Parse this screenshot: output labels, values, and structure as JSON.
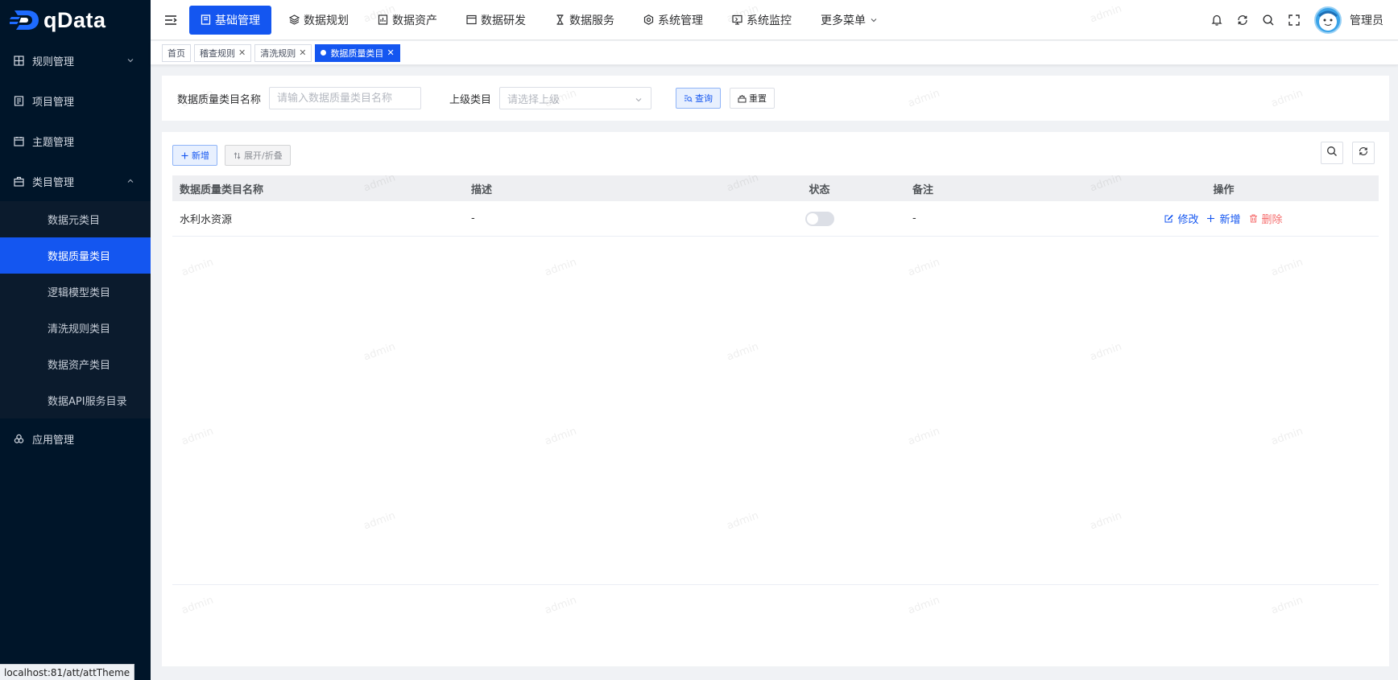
{
  "brand": {
    "name": "qData"
  },
  "sidebar": {
    "items": [
      {
        "label": "规则管理",
        "icon": "grid-icon",
        "expanded": false
      },
      {
        "label": "项目管理",
        "icon": "document-icon"
      },
      {
        "label": "主题管理",
        "icon": "calendar-icon"
      },
      {
        "label": "类目管理",
        "icon": "briefcase-icon",
        "expanded": true,
        "children": [
          {
            "label": "数据元类目"
          },
          {
            "label": "数据质量类目",
            "active": true
          },
          {
            "label": "逻辑模型类目"
          },
          {
            "label": "清洗规则类目"
          },
          {
            "label": "数据资产类目"
          },
          {
            "label": "数据API服务目录"
          }
        ]
      },
      {
        "label": "应用管理",
        "icon": "apps-icon"
      }
    ]
  },
  "topnav": {
    "items": [
      {
        "label": "基础管理",
        "active": true
      },
      {
        "label": "数据规划"
      },
      {
        "label": "数据资产"
      },
      {
        "label": "数据研发"
      },
      {
        "label": "数据服务"
      },
      {
        "label": "系统管理"
      },
      {
        "label": "系统监控"
      },
      {
        "label": "更多菜单"
      }
    ],
    "user": "管理员"
  },
  "tags": [
    {
      "label": "首页"
    },
    {
      "label": "稽查规则"
    },
    {
      "label": "清洗规则"
    },
    {
      "label": "数据质量类目",
      "active": true
    }
  ],
  "search": {
    "name_label": "数据质量类目名称",
    "name_placeholder": "请输入数据质量类目名称",
    "parent_label": "上级类目",
    "parent_placeholder": "请选择上级",
    "query_label": "查询",
    "reset_label": "重置"
  },
  "toolbar": {
    "add_label": "新增",
    "toggle_label": "展开/折叠"
  },
  "table": {
    "headers": [
      "数据质量类目名称",
      "描述",
      "状态",
      "备注",
      "操作"
    ],
    "rows": [
      {
        "name": "水利水资源",
        "desc": "-",
        "status_on": false,
        "remark": "-"
      }
    ],
    "actions": {
      "edit": "修改",
      "add": "新增",
      "delete": "删除"
    }
  },
  "watermark": "admin",
  "statusbar": "localhost:81/att/attTheme",
  "colors": {
    "sidebar_bg": "#001529",
    "primary": "#1456f0",
    "danger": "#f56c6c"
  }
}
